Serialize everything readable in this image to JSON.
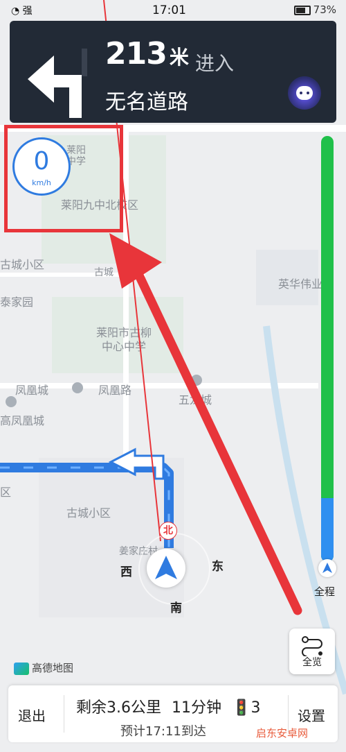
{
  "status_bar": {
    "signal": "强",
    "time": "17:01",
    "battery": "73%"
  },
  "guidance": {
    "distance": "213",
    "distance_unit": "米",
    "action": "进入",
    "road_name": "无名道路"
  },
  "speed": {
    "value": "0",
    "unit": "km/h"
  },
  "map": {
    "labels": [
      "莱阳九中北校区",
      "古城小区",
      "泰家园",
      "英华伟业",
      "莱阳市古柳中心中学",
      "凤凰城",
      "凤凰路",
      "五龙城",
      "高凤凰城",
      "古城小区",
      "姜家庄村",
      "莱阳",
      "中学",
      "区",
      "古城"
    ],
    "compass": {
      "north": "北",
      "south": "南",
      "east": "东",
      "west": "西"
    },
    "logo": "高德地图"
  },
  "route_progress": {
    "label": "全程",
    "completed_fraction": 0.15
  },
  "overview_button": {
    "label": "全览"
  },
  "bottom_bar": {
    "exit": "退出",
    "remaining_prefix": "剩余",
    "remaining_distance": "3.6",
    "distance_unit": "公里",
    "remaining_time": "11",
    "time_unit": "分钟",
    "traffic_lights": "3",
    "eta": "预计17:11到达",
    "settings": "设置"
  },
  "watermark": "启东安卓网",
  "colors": {
    "nav_bg": "#222a36",
    "route_blue": "#2f7be0",
    "progress_green": "#20c04a",
    "highlight_red": "#e8353a"
  }
}
